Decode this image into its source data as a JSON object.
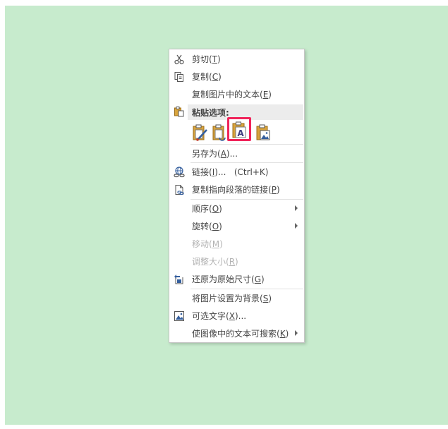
{
  "menu": {
    "cut": {
      "label": "剪切",
      "key": "T"
    },
    "copy": {
      "label": "复制",
      "key": "C"
    },
    "copy_text": {
      "label": "复制图片中的文本",
      "key": "E"
    },
    "paste_options": {
      "label": "粘贴选项:"
    },
    "save_as": {
      "label": "另存为",
      "key": "A",
      "suffix": "..."
    },
    "link": {
      "label": "链接",
      "key": "I",
      "suffix": "...",
      "shortcut": "(Ctrl+K)"
    },
    "copy_link": {
      "label": "复制指向段落的链接",
      "key": "P"
    },
    "order": {
      "label": "顺序",
      "key": "O"
    },
    "rotate": {
      "label": "旋转",
      "key": "O"
    },
    "move": {
      "label": "移动",
      "key": "M"
    },
    "resize": {
      "label": "调整大小",
      "key": "R"
    },
    "restore_size": {
      "label": "还原为原始尺寸",
      "key": "G"
    },
    "set_background": {
      "label": "将图片设置为背景",
      "key": "S"
    },
    "alt_text": {
      "label": "可选文字",
      "key": "X",
      "suffix": "..."
    },
    "searchable": {
      "label": "使图像中的文本可搜索",
      "key": "K"
    }
  },
  "colors": {
    "canvas_bg": "#c7ebcd",
    "highlight_border": "#f0245a"
  }
}
